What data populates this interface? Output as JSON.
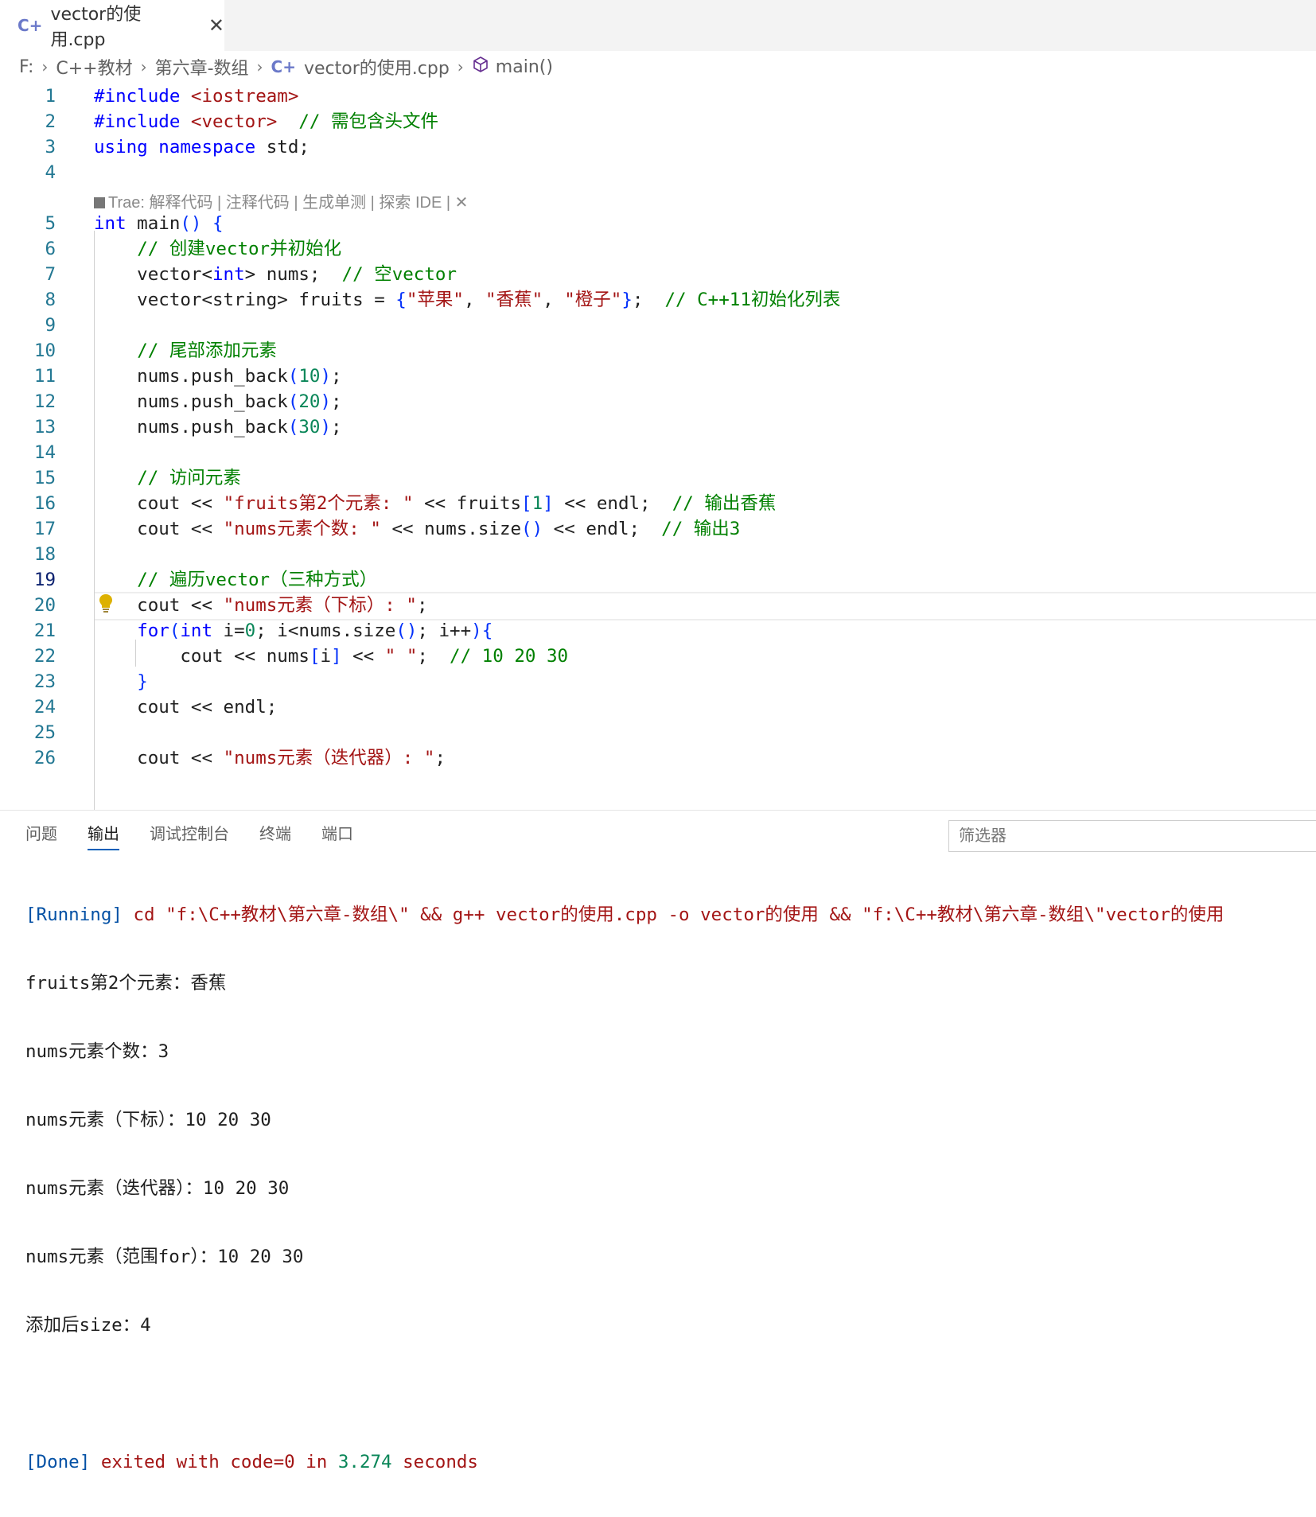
{
  "tab": {
    "title": "vector的使用.cpp",
    "close": "✕"
  },
  "breadcrumb": {
    "drive": "F:",
    "folder1": "C++教材",
    "folder2": "第六章-数组",
    "file": "vector的使用.cpp",
    "symbol": "main()"
  },
  "codelens": "Trae: 解释代码 | 注释代码 | 生成单测 | 探索 IDE | ✕",
  "code_lines": [
    {
      "n": "1",
      "code": "#include <iostream>"
    },
    {
      "n": "2",
      "code": "#include <vector>  // 需包含头文件"
    },
    {
      "n": "3",
      "code": "using namespace std;"
    },
    {
      "n": "4",
      "code": ""
    },
    {
      "n": "5",
      "code": "int main() {"
    },
    {
      "n": "6",
      "code": "    // 创建vector并初始化"
    },
    {
      "n": "7",
      "code": "    vector<int> nums;  // 空vector"
    },
    {
      "n": "8",
      "code": "    vector<string> fruits = {\"苹果\", \"香蕉\", \"橙子\"};  // C++11初始化列表"
    },
    {
      "n": "9",
      "code": ""
    },
    {
      "n": "10",
      "code": "    // 尾部添加元素"
    },
    {
      "n": "11",
      "code": "    nums.push_back(10);"
    },
    {
      "n": "12",
      "code": "    nums.push_back(20);"
    },
    {
      "n": "13",
      "code": "    nums.push_back(30);"
    },
    {
      "n": "14",
      "code": ""
    },
    {
      "n": "15",
      "code": "    // 访问元素"
    },
    {
      "n": "16",
      "code": "    cout << \"fruits第2个元素: \" << fruits[1] << endl;  // 输出香蕉"
    },
    {
      "n": "17",
      "code": "    cout << \"nums元素个数: \" << nums.size() << endl;  // 输出3"
    },
    {
      "n": "18",
      "code": ""
    },
    {
      "n": "19",
      "code": "    // 遍历vector（三种方式）"
    },
    {
      "n": "20",
      "code": "    cout << \"nums元素（下标）: \";"
    },
    {
      "n": "21",
      "code": "    for(int i=0; i<nums.size(); i++){"
    },
    {
      "n": "22",
      "code": "        cout << nums[i] << \" \";  // 10 20 30"
    },
    {
      "n": "23",
      "code": "    }"
    },
    {
      "n": "24",
      "code": "    cout << endl;"
    },
    {
      "n": "25",
      "code": ""
    },
    {
      "n": "26",
      "code": "    cout << \"nums元素（迭代器）: \";"
    }
  ],
  "panel": {
    "tabs": [
      "问题",
      "输出",
      "调试控制台",
      "终端",
      "端口"
    ],
    "active_tab": "输出",
    "filter_placeholder": "筛选器"
  },
  "output": {
    "running_tag": "[Running]",
    "running_cmd": "cd \"f:\\C++教材\\第六章-数组\\\" && g++ vector的使用.cpp -o vector的使用 && \"f:\\C++教材\\第六章-数组\\\"vector的使用",
    "lines": [
      "fruits第2个元素：香蕉",
      "nums元素个数：3",
      "nums元素（下标）：10 20 30",
      "nums元素（迭代器）：10 20 30",
      "nums元素（范围for）：10 20 30",
      "添加后size：4"
    ],
    "done_tag": "[Done]",
    "done_pre": "exited with code=0 in",
    "done_time": "3.274",
    "done_post": "seconds"
  }
}
